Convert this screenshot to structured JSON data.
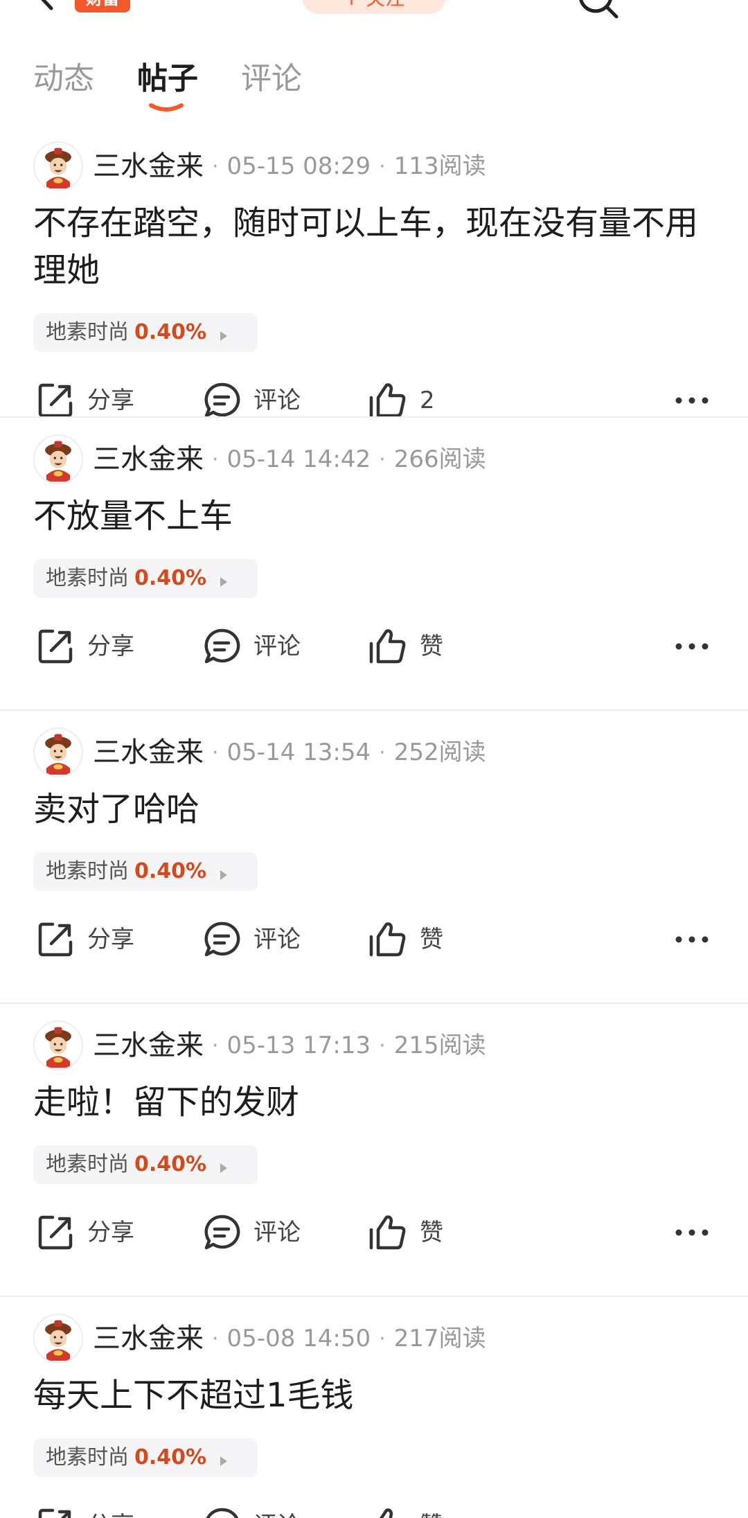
{
  "header": {
    "badge_text": "财富",
    "follow_text": "+ 关注"
  },
  "tabs": [
    {
      "label": "动态",
      "active": false
    },
    {
      "label": "帖子",
      "active": true
    },
    {
      "label": "评论",
      "active": false
    }
  ],
  "colors": {
    "accent": "#f35a2b",
    "stock_pct": "#d44a1d",
    "muted_text": "#999999"
  },
  "actions": {
    "share_label": "分享",
    "comment_label": "评论"
  },
  "posts": [
    {
      "author": "三水金来",
      "time": "05-15 08:29",
      "reads": "113阅读",
      "content": "不存在踏空，随时可以上车，现在没有量不用理她",
      "stock_name": "地素时尚",
      "stock_pct": "0.40%",
      "like_label": "2"
    },
    {
      "author": "三水金来",
      "time": "05-14 14:42",
      "reads": "266阅读",
      "content": "不放量不上车",
      "stock_name": "地素时尚",
      "stock_pct": "0.40%",
      "like_label": "赞"
    },
    {
      "author": "三水金来",
      "time": "05-14 13:54",
      "reads": "252阅读",
      "content": "卖对了哈哈",
      "stock_name": "地素时尚",
      "stock_pct": "0.40%",
      "like_label": "赞"
    },
    {
      "author": "三水金来",
      "time": "05-13 17:13",
      "reads": "215阅读",
      "content": "走啦！留下的发财",
      "stock_name": "地素时尚",
      "stock_pct": "0.40%",
      "like_label": "赞"
    },
    {
      "author": "三水金来",
      "time": "05-08 14:50",
      "reads": "217阅读",
      "content": "每天上下不超过1毛钱",
      "stock_name": "地素时尚",
      "stock_pct": "0.40%",
      "like_label": "赞"
    }
  ]
}
